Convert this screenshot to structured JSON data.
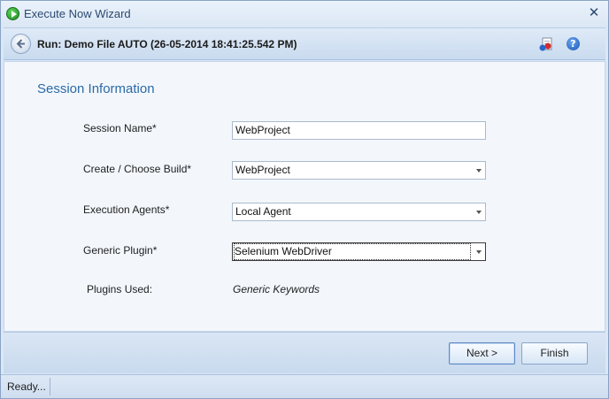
{
  "window": {
    "title": "Execute Now Wizard",
    "close_symbol": "✕"
  },
  "header": {
    "title": "Run: Demo File AUTO (26-05-2014 18:41:25.542 PM)",
    "help_symbol": "?"
  },
  "section": {
    "title": "Session Information"
  },
  "form": {
    "session_name_label": "Session Name*",
    "session_name_value": "WebProject",
    "build_label": "Create / Choose Build*",
    "build_value": "WebProject",
    "agents_label": "Execution Agents*",
    "agents_value": "Local Agent",
    "plugin_label": "Generic Plugin*",
    "plugin_value": "Selenium WebDriver",
    "plugins_used_label": "Plugins Used:",
    "plugins_used_value": "Generic Keywords"
  },
  "buttons": {
    "next_label": "Next >",
    "finish_label": "Finish"
  },
  "status": {
    "text": "Ready..."
  },
  "colors": {
    "accent": "#2a6aa6",
    "window_bg": "#dbe7f5",
    "panel_bg": "#f3f7fc"
  },
  "icons": {
    "title": "play-icon",
    "back": "back-arrow-icon",
    "record": "record-icon",
    "help": "help-icon"
  }
}
